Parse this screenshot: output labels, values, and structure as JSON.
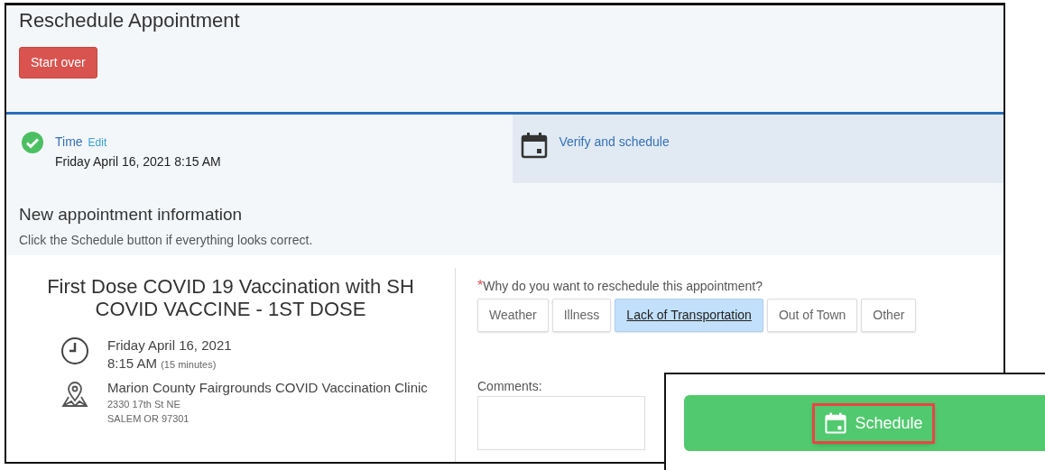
{
  "title": "Reschedule Appointment",
  "start_over": "Start over",
  "steps": [
    {
      "kind": "done",
      "label": "Time",
      "edit": "Edit",
      "value": "Friday April 16, 2021 8:15 AM",
      "selected": false
    },
    {
      "kind": "pending",
      "label": "Verify and schedule",
      "selected": true
    }
  ],
  "section": {
    "heading": "New appointment information",
    "subtitle": "Click the Schedule button if everything looks correct."
  },
  "appointment": {
    "title": "First Dose COVID 19 Vaccination with SH COVID VACCINE - 1ST DOSE",
    "date": "Friday April 16, 2021",
    "time": "8:15 AM",
    "duration": "(15 minutes)",
    "location": "Marion County Fairgrounds COVID Vaccination Clinic",
    "address": [
      "2330 17th St NE",
      "SALEM OR 97301"
    ]
  },
  "reason": {
    "required_mark": "*",
    "question": "Why do you want to reschedule this appointment?",
    "options": [
      {
        "label": "Weather",
        "selected": false
      },
      {
        "label": "Illness",
        "selected": false
      },
      {
        "label": "Lack of Transportation",
        "selected": true
      },
      {
        "label": "Out of Town",
        "selected": false
      },
      {
        "label": "Other",
        "selected": false
      }
    ]
  },
  "comments": {
    "label": "Comments:"
  },
  "inset": {
    "schedule_button": "Schedule",
    "highlighted": true
  }
}
